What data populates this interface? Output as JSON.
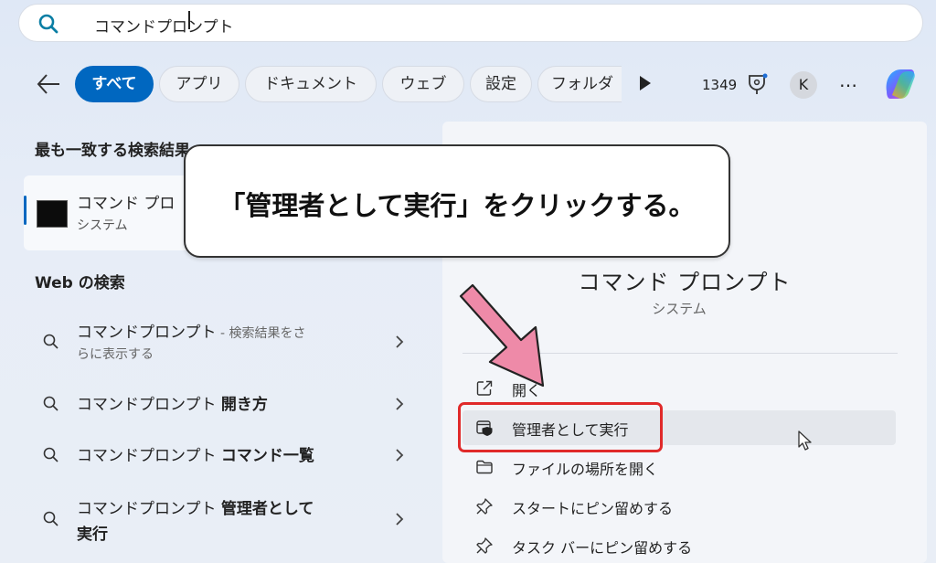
{
  "search": {
    "value": "コマンドプロンプト"
  },
  "filters": {
    "back_label": "",
    "chips": [
      "すべて",
      "アプリ",
      "ドキュメント",
      "ウェブ",
      "設定",
      "フォルダ"
    ],
    "points": "1349",
    "avatar": "K",
    "more": "…"
  },
  "left": {
    "best_match_title": "最も一致する検索結果",
    "best_match": {
      "name": "コマンド プロ",
      "type": "システム"
    },
    "web_title": "Web の検索",
    "web_items": [
      {
        "main": "コマンドプロンプト",
        "suffix": " - 検索結果をさ",
        "line2": "らに表示する"
      },
      {
        "main": "コマンドプロンプト ",
        "bold": "開き方"
      },
      {
        "main": "コマンドプロンプト ",
        "bold": "コマンド一覧"
      },
      {
        "main": "コマンドプロンプト ",
        "bold": "管理者として",
        "line2_bold": "実行"
      }
    ]
  },
  "right": {
    "app_name": "コマンド プロンプト",
    "app_type": "システム",
    "actions": [
      {
        "icon": "open-icon",
        "label": "開く"
      },
      {
        "icon": "shield-icon",
        "label": "管理者として実行"
      },
      {
        "icon": "folder-icon",
        "label": "ファイルの場所を開く"
      },
      {
        "icon": "pin-icon",
        "label": "スタートにピン留めする"
      },
      {
        "icon": "pin-icon",
        "label": "タスク バーにピン留めする"
      }
    ]
  },
  "callout": {
    "text": "「管理者として実行」をクリックする。"
  },
  "colors": {
    "accent": "#0067c0",
    "highlight_box": "#e02a2a",
    "arrow": "#ee8aa8"
  }
}
